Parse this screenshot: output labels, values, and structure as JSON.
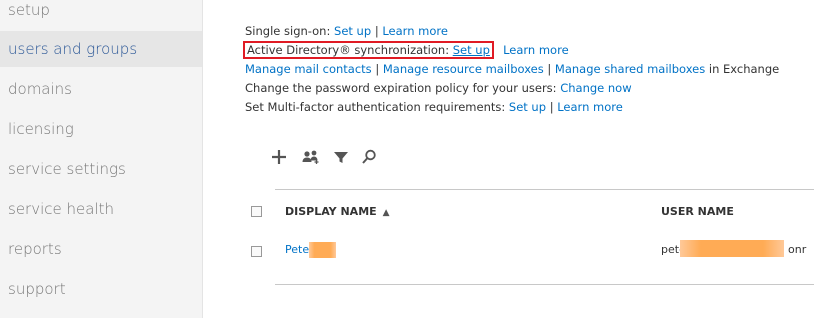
{
  "sidebar": {
    "items": [
      {
        "label": "setup",
        "active": false
      },
      {
        "label": "users and groups",
        "active": true
      },
      {
        "label": "domains",
        "active": false
      },
      {
        "label": "licensing",
        "active": false
      },
      {
        "label": "service settings",
        "active": false
      },
      {
        "label": "service health",
        "active": false
      },
      {
        "label": "reports",
        "active": false
      },
      {
        "label": "support",
        "active": false
      }
    ]
  },
  "settings": {
    "sso": {
      "label": "Single sign-on:",
      "setup": "Set up",
      "sep": "|",
      "learn": "Learn more"
    },
    "ad_sync": {
      "label": "Active Directory® synchronization:",
      "setup": "Set up",
      "sep": "|",
      "learn": "Learn more"
    },
    "manage": {
      "mail_contacts": "Manage mail contacts",
      "sep1": "|",
      "resource": "Manage resource mailboxes",
      "sep2": "|",
      "shared": "Manage shared mailboxes",
      "suffix": "in Exchange"
    },
    "password": {
      "label": "Change the password expiration policy for your users:",
      "link": "Change now"
    },
    "mfa": {
      "label": "Set Multi-factor authentication requirements:",
      "setup": "Set up",
      "sep": "|",
      "learn": "Learn more"
    }
  },
  "toolbar": {
    "icons": [
      "plus-icon",
      "people-icon",
      "filter-icon",
      "search-icon"
    ]
  },
  "table": {
    "columns": {
      "display_name": "DISPLAY NAME",
      "sort_indicator": "▲",
      "user_name": "USER NAME"
    },
    "rows": [
      {
        "display_name": "Pete",
        "user_name_start": "pete",
        "user_name_end": "onr"
      }
    ]
  },
  "colors": {
    "link": "#0072c6",
    "highlight_box": "#e01b24",
    "redaction": "#ffab55",
    "active_nav": "#e6e6e6"
  }
}
